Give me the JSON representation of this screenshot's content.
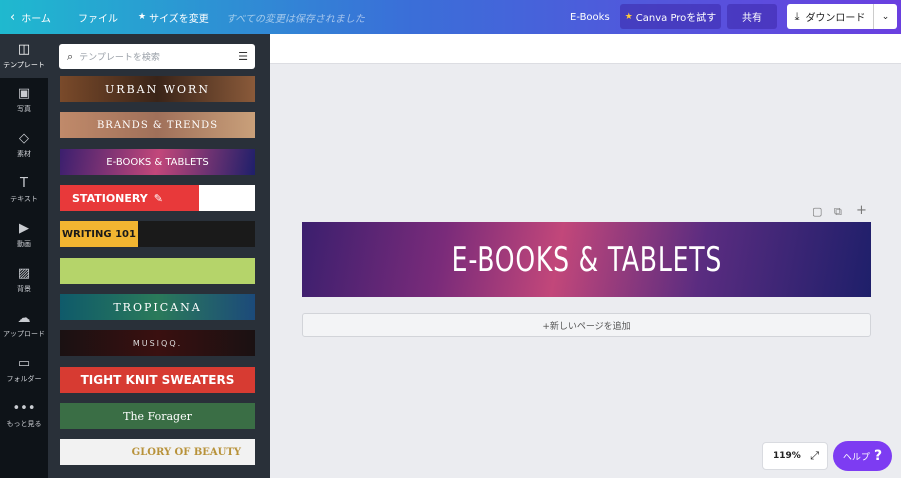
{
  "topbar": {
    "home_label": "ホーム",
    "file_label": "ファイル",
    "resize_label": "サイズを変更",
    "saved_status": "すべての変更は保存されました",
    "doc_type": "E-Books",
    "pro_label": "Canva Proを試す",
    "share_label": "共有",
    "download_label": "ダウンロード"
  },
  "rail": {
    "items": [
      {
        "label": "テンプレート",
        "icon": "template-icon"
      },
      {
        "label": "写真",
        "icon": "photo-icon"
      },
      {
        "label": "素材",
        "icon": "elements-icon"
      },
      {
        "label": "テキスト",
        "icon": "text-icon"
      },
      {
        "label": "動画",
        "icon": "video-icon"
      },
      {
        "label": "背景",
        "icon": "background-icon"
      },
      {
        "label": "アップロード",
        "icon": "upload-icon"
      },
      {
        "label": "フォルダー",
        "icon": "folder-icon"
      },
      {
        "label": "もっと見る",
        "icon": "more-icon"
      }
    ]
  },
  "panel": {
    "search_placeholder": "テンプレートを検索",
    "templates": [
      {
        "text": "URBAN WORN",
        "bg": "#5a3a22"
      },
      {
        "text": "BRANDS & TRENDS",
        "bg": "#b37a6a"
      },
      {
        "text": "E-BOOKS & TABLETS",
        "bg": "#7a2f85"
      },
      {
        "text": "STATIONERY",
        "bg": "#e8393a"
      },
      {
        "text": "WRITING 101",
        "bg": "#1a1a1a"
      },
      {
        "text": "",
        "bg": "#b5d46a"
      },
      {
        "text": "TROPICANA",
        "bg": "#1c6a6a"
      },
      {
        "text": "MUSIQQ.",
        "bg": "#1a1112"
      },
      {
        "text": "TIGHT KNIT SWEATERS",
        "bg": "#d73b32"
      },
      {
        "text": "The Forager",
        "bg": "#3a6e45"
      },
      {
        "text": "GLORY OF BEAUTY",
        "bg": "#f2f2f2"
      }
    ]
  },
  "canvas": {
    "banner_text": "E-BOOKS & TABLETS",
    "add_page_label": "+新しいページを追加",
    "zoom_value": "119%",
    "help_label": "ヘルプ",
    "help_mark": "?"
  }
}
